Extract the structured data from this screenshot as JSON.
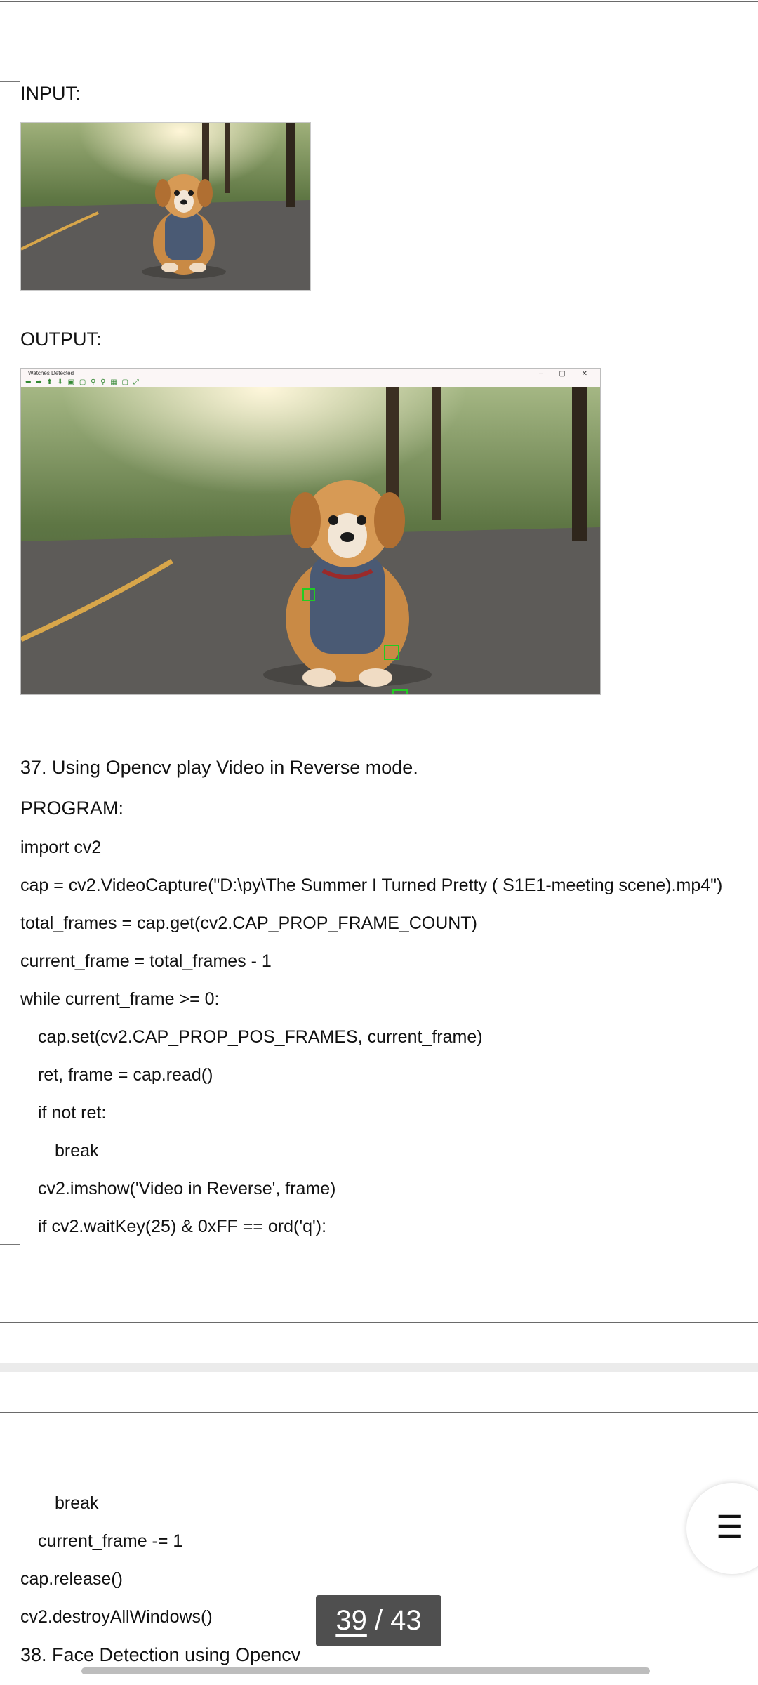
{
  "page_top": {
    "input_label": "INPUT:",
    "output_label": "OUTPUT:"
  },
  "output_window": {
    "title": "Watches Detected",
    "tools": "⬅ ➡ ⬆ ⬇ ▣ ▢ ⚲ ⚲ ▦ ▢ ⤢",
    "controls": "– ▢ ✕"
  },
  "section37": {
    "heading": "37. Using Opencv play Video in Reverse mode.",
    "program_label": "PROGRAM:",
    "code_lines": [
      {
        "indent": 0,
        "text": "import cv2"
      },
      {
        "indent": 0,
        "text": "cap = cv2.VideoCapture(\"D:\\py\\The Summer I Turned Pretty ( S1E1-meeting scene).mp4\")"
      },
      {
        "indent": 0,
        "text": "total_frames = cap.get(cv2.CAP_PROP_FRAME_COUNT)"
      },
      {
        "indent": 0,
        "text": "current_frame = total_frames - 1"
      },
      {
        "indent": 0,
        "text": "while current_frame >= 0:"
      },
      {
        "indent": 1,
        "text": "cap.set(cv2.CAP_PROP_POS_FRAMES, current_frame)"
      },
      {
        "indent": 1,
        "text": "ret, frame = cap.read()"
      },
      {
        "indent": 1,
        "text": "if not ret:"
      },
      {
        "indent": 2,
        "text": "break"
      },
      {
        "indent": 1,
        "text": "cv2.imshow('Video in Reverse', frame)"
      },
      {
        "indent": 1,
        "text": "if cv2.waitKey(25) & 0xFF == ord('q'):"
      }
    ]
  },
  "page_next": {
    "code_lines": [
      {
        "indent": 2,
        "text": "break"
      },
      {
        "indent": 1,
        "text": "current_frame -= 1"
      },
      {
        "indent": 0,
        "text": "cap.release()"
      },
      {
        "indent": 0,
        "text": "cv2.destroyAllWindows()"
      }
    ],
    "section38_heading": "38. Face Detection using Opencv"
  },
  "pager": {
    "current": "39",
    "separator": " / ",
    "total": "43"
  },
  "icons": {
    "menu": "hamburger-menu-icon"
  },
  "colors": {
    "pager_bg": "#4f4f4f",
    "detection_box": "#22cc22"
  }
}
